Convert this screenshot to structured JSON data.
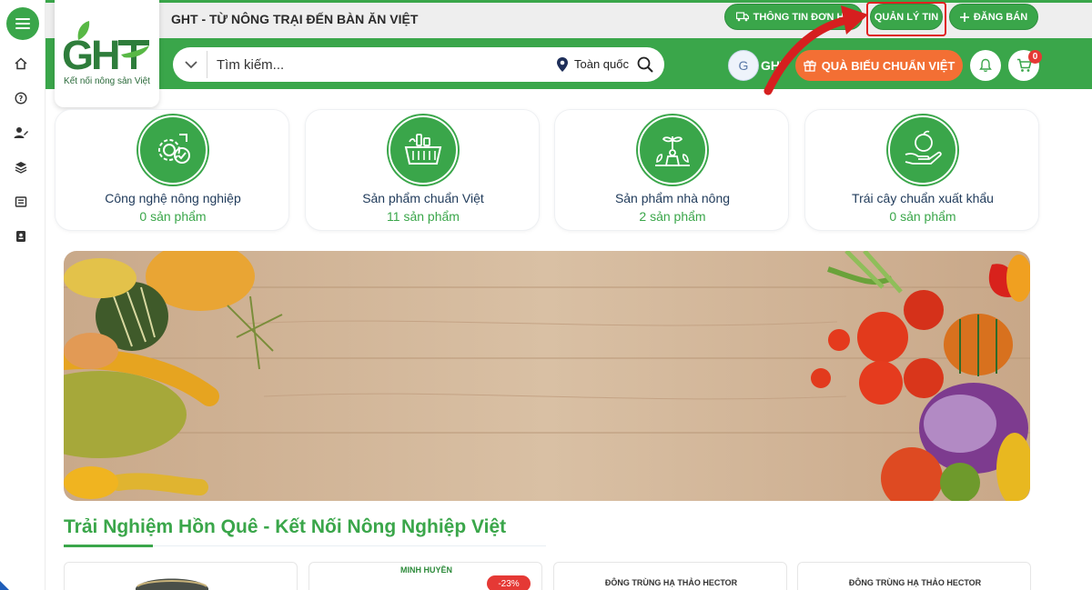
{
  "header": {
    "site_title": "GHT - TỪ NÔNG TRẠI ĐẾN BÀN ĂN VIỆT",
    "order_info_label": "THÔNG TIN ĐƠN HÀ",
    "manage_posts_label": "QUẢN LÝ TIN",
    "post_sale_label": "ĐĂNG BÁN"
  },
  "logo": {
    "mark": "GHT",
    "tagline": "Kết nối nông sản Việt"
  },
  "search": {
    "placeholder": "Tìm kiếm...",
    "region": "Toàn quốc"
  },
  "user": {
    "avatar_letter": "G",
    "name": "GHT"
  },
  "gift_button": {
    "label": "QUÀ BIẾU CHUẨN VIỆT"
  },
  "cart": {
    "count": "0"
  },
  "categories": [
    {
      "name": "Công nghệ nông nghiệp",
      "count": "0 sản phẩm",
      "icon": "gear-check-icon"
    },
    {
      "name": "Sản phẩm chuẩn Việt",
      "count": "11 sản phẩm",
      "icon": "basket-icon"
    },
    {
      "name": "Sản phẩm nhà nông",
      "count": "2 sản phẩm",
      "icon": "farmer-plant-icon"
    },
    {
      "name": "Trái cây chuẩn xuất khẩu",
      "count": "0 sản phẩm",
      "icon": "hand-fruit-icon"
    }
  ],
  "section": {
    "title": "Trải Nghiệm Hồn Quê - Kết Nối Nông Nghiệp Việt"
  },
  "products": [
    {
      "brand": "",
      "discount": ""
    },
    {
      "brand": "MINH HUYỀN",
      "discount": "-23%"
    },
    {
      "brand": "ĐÔNG TRÙNG HẠ THẢO HECTOR",
      "discount": ""
    },
    {
      "brand": "ĐÔNG TRÙNG HẠ THẢO HECTOR",
      "discount": ""
    }
  ],
  "colors": {
    "brand_green": "#3aa64a",
    "accent_orange": "#f36f34",
    "annotation_red": "#e02020"
  }
}
